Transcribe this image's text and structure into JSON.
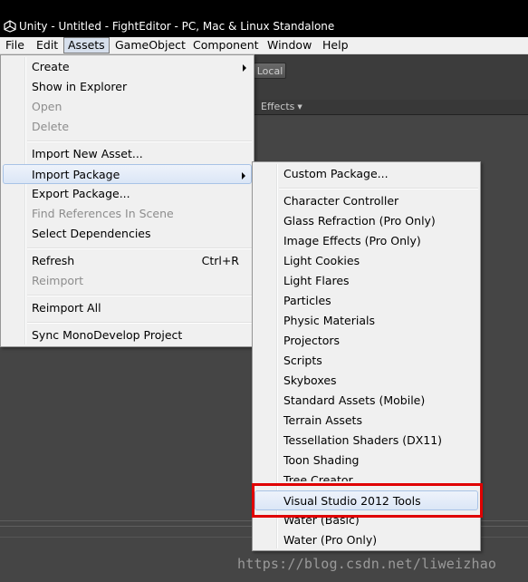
{
  "window": {
    "title": "Unity - Untitled - FightEditor - PC, Mac & Linux Standalone"
  },
  "menubar": {
    "items": [
      "File",
      "Edit",
      "Assets",
      "GameObject",
      "Component",
      "Window",
      "Help"
    ],
    "active": "Assets"
  },
  "editor": {
    "local_button": "Local",
    "effects_label": "Effects"
  },
  "assets_menu": {
    "create": "Create",
    "show_in_explorer": "Show in Explorer",
    "open": "Open",
    "delete": "Delete",
    "import_new_asset": "Import New Asset...",
    "import_package": "Import Package",
    "export_package": "Export Package...",
    "find_references": "Find References In Scene",
    "select_dependencies": "Select Dependencies",
    "refresh": "Refresh",
    "refresh_shortcut": "Ctrl+R",
    "reimport": "Reimport",
    "reimport_all": "Reimport All",
    "sync_mono": "Sync MonoDevelop Project"
  },
  "import_package_menu": {
    "custom": "Custom Package...",
    "items": [
      "Character Controller",
      "Glass Refraction (Pro Only)",
      "Image Effects (Pro Only)",
      "Light Cookies",
      "Light Flares",
      "Particles",
      "Physic Materials",
      "Projectors",
      "Scripts",
      "Skyboxes",
      "Standard Assets (Mobile)",
      "Terrain Assets",
      "Tessellation Shaders (DX11)",
      "Toon Shading",
      "Tree Creator",
      "Visual Studio 2012 Tools",
      "Water (Basic)",
      "Water (Pro Only)"
    ]
  },
  "watermark": "https://blog.csdn.net/liweizhao"
}
